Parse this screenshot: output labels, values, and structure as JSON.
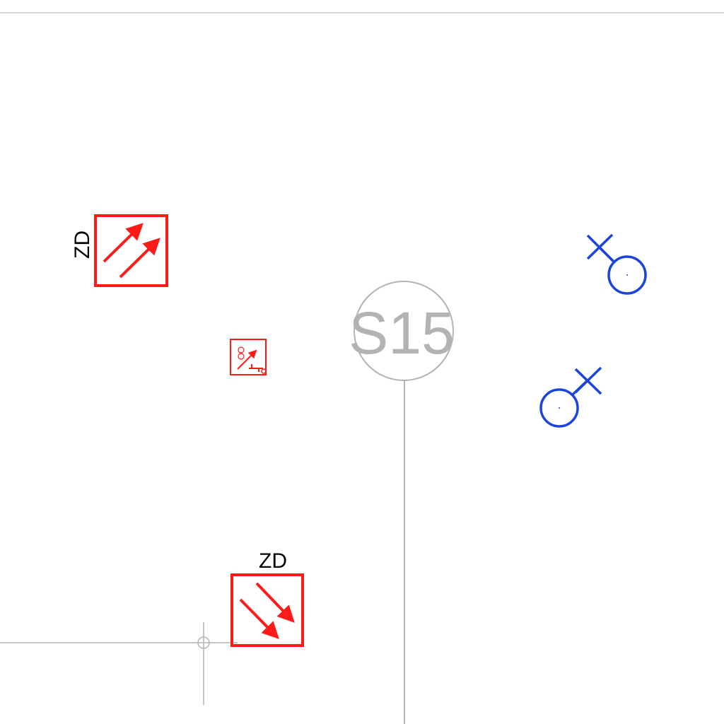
{
  "drawing": {
    "grid_bubble_label": "S15",
    "fire_damper_label": "ZD"
  },
  "colors": {
    "background": "#ffffff",
    "grid_line": "#b3b3b3",
    "border_line": "#cccccc",
    "fire_symbol": "#ff1a1a",
    "sprinkler_symbol": "#1a44dd",
    "text": "#000000"
  },
  "symbols": [
    {
      "type": "fire-damper",
      "direction": "up-right",
      "label": "ZD"
    },
    {
      "type": "fire-damper",
      "direction": "down-right",
      "label": "ZD"
    },
    {
      "type": "fire-detector-small"
    },
    {
      "type": "sprinkler-head"
    },
    {
      "type": "sprinkler-head"
    }
  ]
}
